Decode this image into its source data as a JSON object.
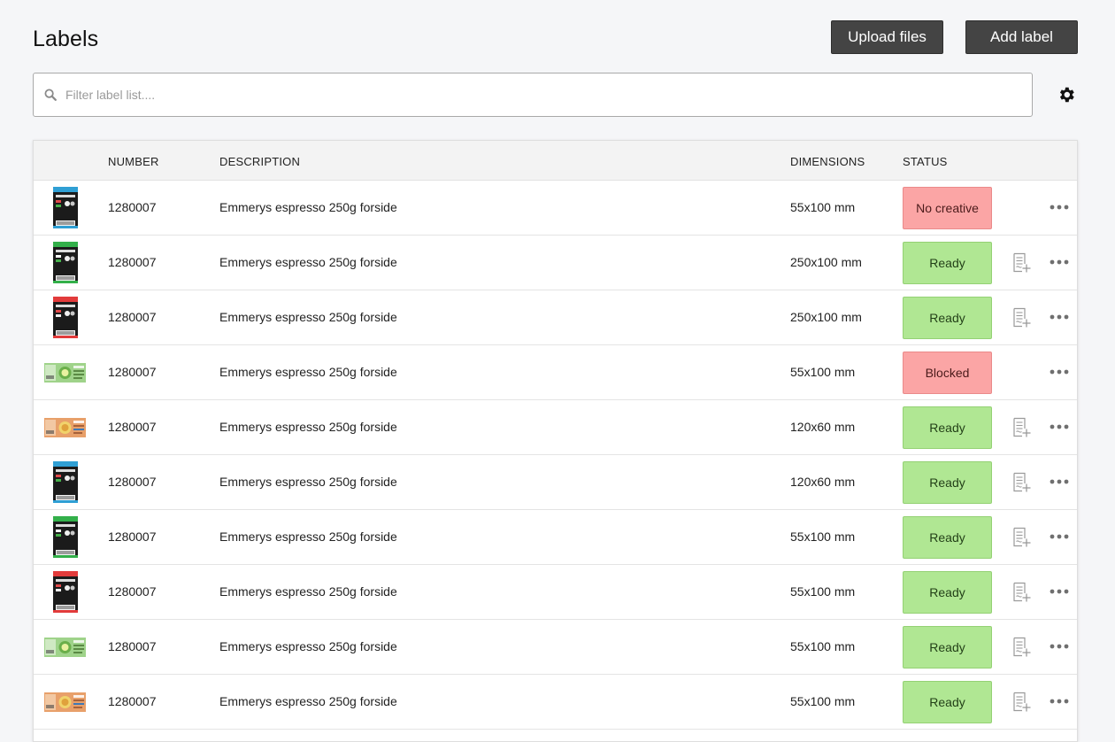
{
  "header": {
    "title": "Labels",
    "upload_label": "Upload files",
    "add_label": "Add label"
  },
  "search": {
    "placeholder": "Filter label list....",
    "value": ""
  },
  "icons": {
    "search": "search-icon",
    "settings": "gear-icon",
    "add_document": "add-document-icon",
    "more": "more-options-icon"
  },
  "colors": {
    "button_bg": "#444444",
    "status_ready": "#b0e793",
    "status_bad": "#fba5a5",
    "page_bg": "#f5f6f8"
  },
  "table": {
    "columns": {
      "number": "NUMBER",
      "description": "DESCRIPTION",
      "dimensions": "DIMENSIONS",
      "status": "STATUS"
    },
    "rows": [
      {
        "thumb": "blue",
        "number": "1280007",
        "description": "Emmerys espresso 250g forside",
        "dimensions": "55x100 mm",
        "status": "No creative",
        "status_kind": "bad",
        "has_add_doc": false
      },
      {
        "thumb": "green",
        "number": "1280007",
        "description": "Emmerys espresso 250g forside",
        "dimensions": "250x100 mm",
        "status": "Ready",
        "status_kind": "ready",
        "has_add_doc": true
      },
      {
        "thumb": "red",
        "number": "1280007",
        "description": "Emmerys espresso 250g forside",
        "dimensions": "250x100 mm",
        "status": "Ready",
        "status_kind": "ready",
        "has_add_doc": true
      },
      {
        "thumb": "wide-green",
        "number": "1280007",
        "description": "Emmerys espresso 250g forside",
        "dimensions": "55x100 mm",
        "status": "Blocked",
        "status_kind": "bad",
        "has_add_doc": false
      },
      {
        "thumb": "wide-orange",
        "number": "1280007",
        "description": "Emmerys espresso 250g forside",
        "dimensions": "120x60 mm",
        "status": "Ready",
        "status_kind": "ready",
        "has_add_doc": true
      },
      {
        "thumb": "blue",
        "number": "1280007",
        "description": "Emmerys espresso 250g forside",
        "dimensions": "120x60 mm",
        "status": "Ready",
        "status_kind": "ready",
        "has_add_doc": true
      },
      {
        "thumb": "green",
        "number": "1280007",
        "description": "Emmerys espresso 250g forside",
        "dimensions": "55x100 mm",
        "status": "Ready",
        "status_kind": "ready",
        "has_add_doc": true
      },
      {
        "thumb": "red",
        "number": "1280007",
        "description": "Emmerys espresso 250g forside",
        "dimensions": "55x100 mm",
        "status": "Ready",
        "status_kind": "ready",
        "has_add_doc": true
      },
      {
        "thumb": "wide-green",
        "number": "1280007",
        "description": "Emmerys espresso 250g forside",
        "dimensions": "55x100 mm",
        "status": "Ready",
        "status_kind": "ready",
        "has_add_doc": true
      },
      {
        "thumb": "wide-orange",
        "number": "1280007",
        "description": "Emmerys espresso 250g forside",
        "dimensions": "55x100 mm",
        "status": "Ready",
        "status_kind": "ready",
        "has_add_doc": true
      }
    ]
  }
}
